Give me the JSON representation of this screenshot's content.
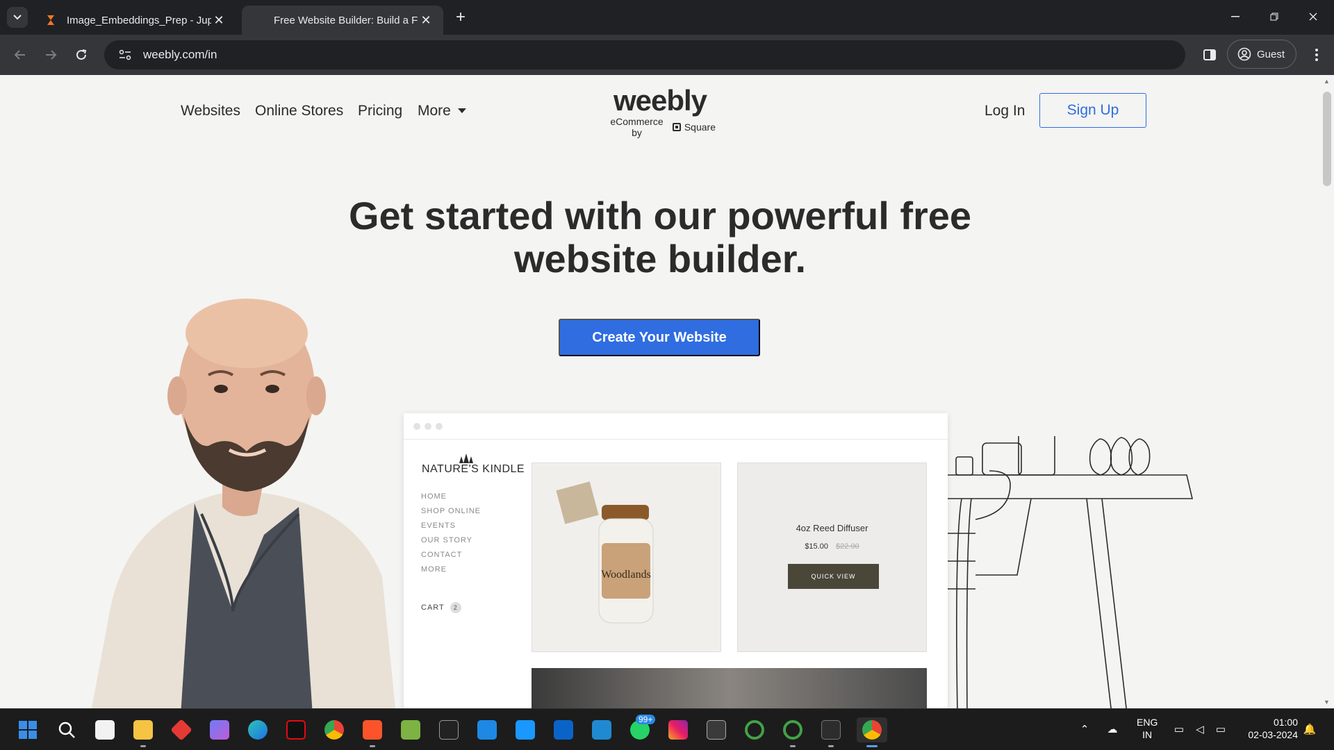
{
  "browser": {
    "tabs": [
      {
        "title": "Image_Embeddings_Prep - Jupy",
        "active": false
      },
      {
        "title": "Free Website Builder: Build a Fre",
        "active": true
      }
    ],
    "url": "weebly.com/in",
    "profile_label": "Guest"
  },
  "page": {
    "nav": {
      "items": [
        "Websites",
        "Online Stores",
        "Pricing",
        "More"
      ],
      "login": "Log In",
      "signup": "Sign Up"
    },
    "logo": {
      "word": "weebly",
      "sub_left": "eCommerce by",
      "sub_right": "Square"
    },
    "headline_line1": "Get started with our powerful free",
    "headline_line2": "website builder.",
    "cta": "Create Your Website",
    "mock": {
      "brand": "NATURE'S KINDLE",
      "menu": [
        "HOME",
        "SHOP ONLINE",
        "EVENTS",
        "OUR STORY",
        "CONTACT",
        "MORE"
      ],
      "cart_label": "CART",
      "cart_count": "2",
      "jar_label": "Woodlands",
      "product_name": "4oz Reed Diffuser",
      "price": "$15.00",
      "old_price": "$22.00",
      "quick_view": "QUICK VIEW"
    }
  },
  "taskbar": {
    "whatsapp_badge": "99+",
    "lang_line1": "ENG",
    "lang_line2": "IN",
    "time": "01:00",
    "date": "02-03-2024"
  },
  "colors": {
    "accent_blue": "#2f6de1",
    "page_bg": "#f4f4f3",
    "chrome_dark": "#202124"
  }
}
